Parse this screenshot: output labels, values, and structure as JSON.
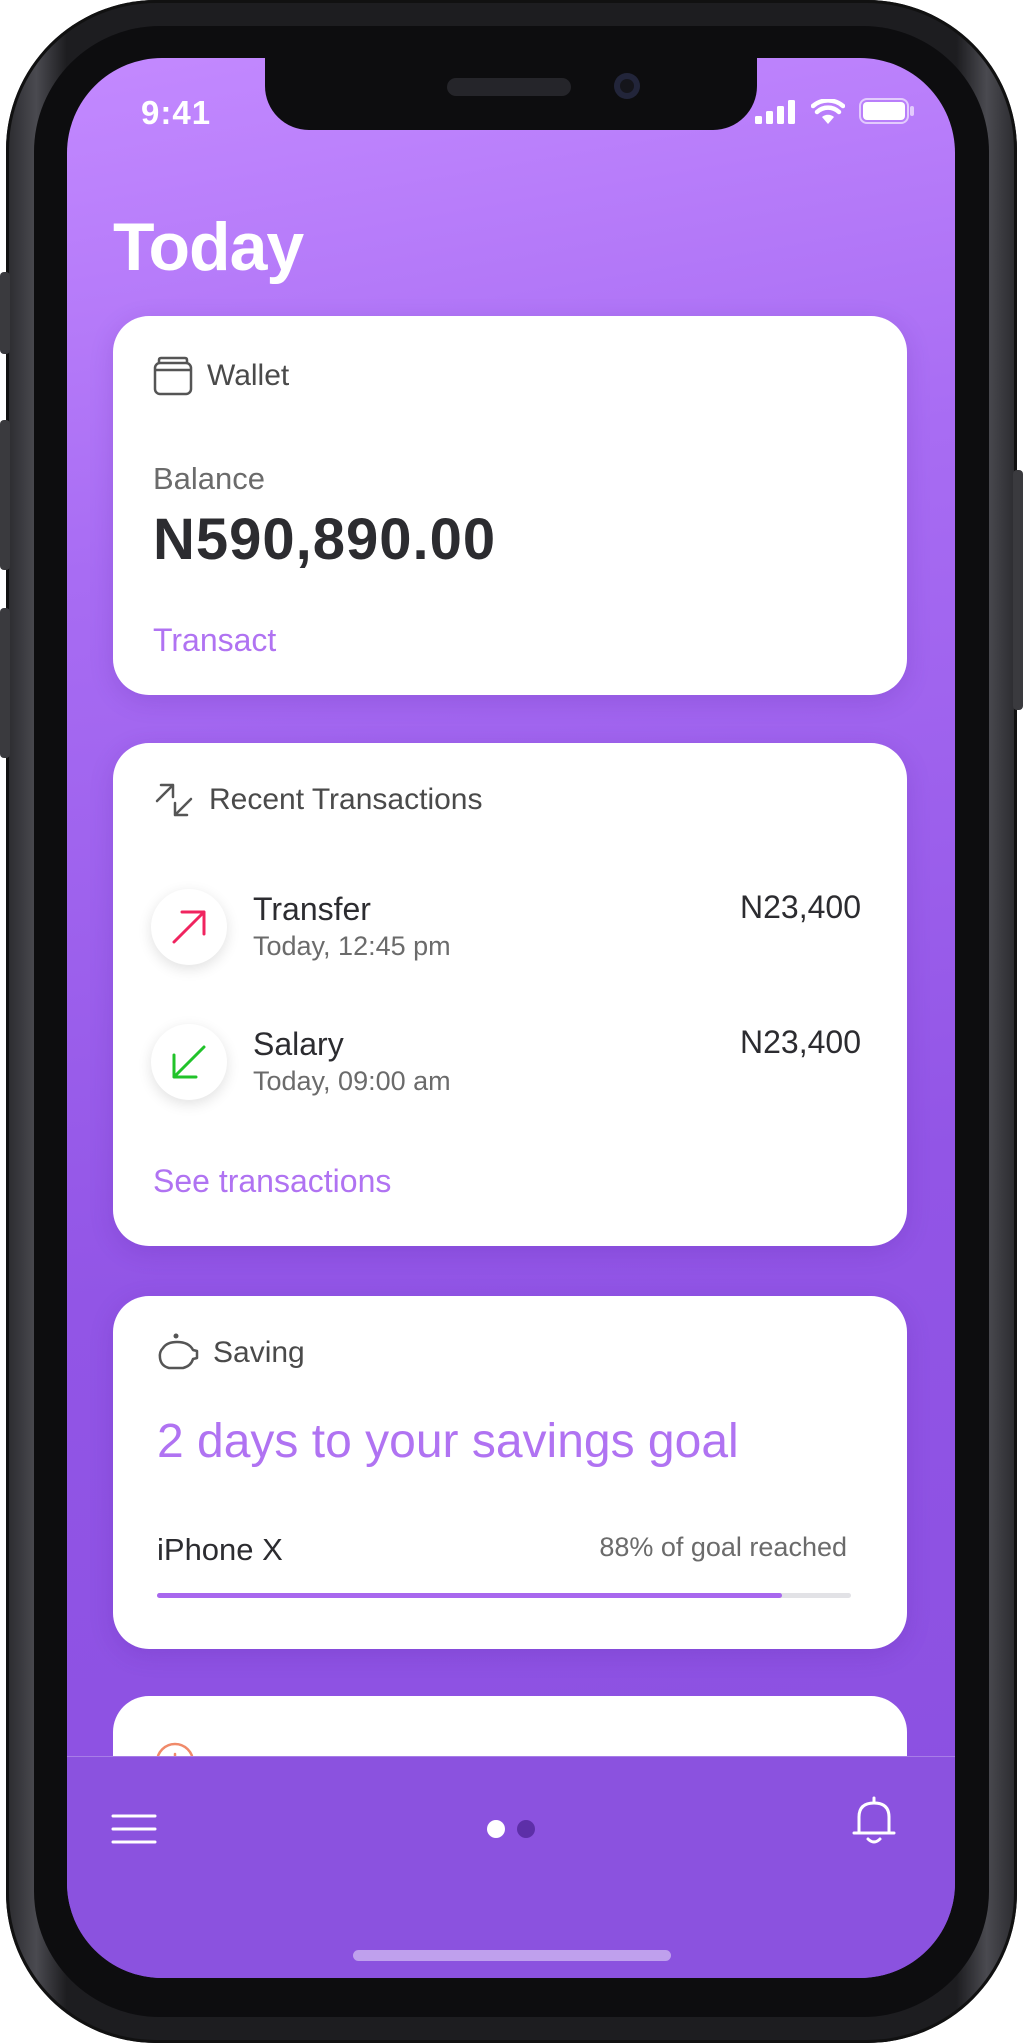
{
  "status_bar": {
    "time": "9:41"
  },
  "header": {
    "title": "Today"
  },
  "wallet": {
    "label": "Wallet",
    "balance_label": "Balance",
    "balance_value": "N590,890.00",
    "action_label": "Transact"
  },
  "transactions": {
    "label": "Recent Transactions",
    "items": [
      {
        "name": "Transfer",
        "time": "Today, 12:45 pm",
        "amount": "N23,400",
        "direction": "outgoing",
        "icon": "arrow-up-right-icon",
        "color": "#f0245f"
      },
      {
        "name": "Salary",
        "time": "Today, 09:00 am",
        "amount": "N23,400",
        "direction": "incoming",
        "icon": "arrow-down-left-icon",
        "color": "#21c32a"
      }
    ],
    "link_label": "See transactions"
  },
  "saving": {
    "label": "Saving",
    "goal_text": "2 days to your savings goal",
    "item_name": "iPhone X",
    "progress_text": "88% of goal reached",
    "progress_fraction": 0.9
  },
  "next_card": {
    "icon": "info-icon"
  },
  "tabbar": {
    "left_icon": "menu-icon",
    "right_icon": "bell-icon",
    "page_indicator": {
      "count": 2,
      "active_index": 0
    }
  },
  "colors": {
    "accent": "#b073f2",
    "background_top": "#c389ff",
    "background_bottom": "#8a4fe0",
    "tabbar": "#8b52df"
  }
}
